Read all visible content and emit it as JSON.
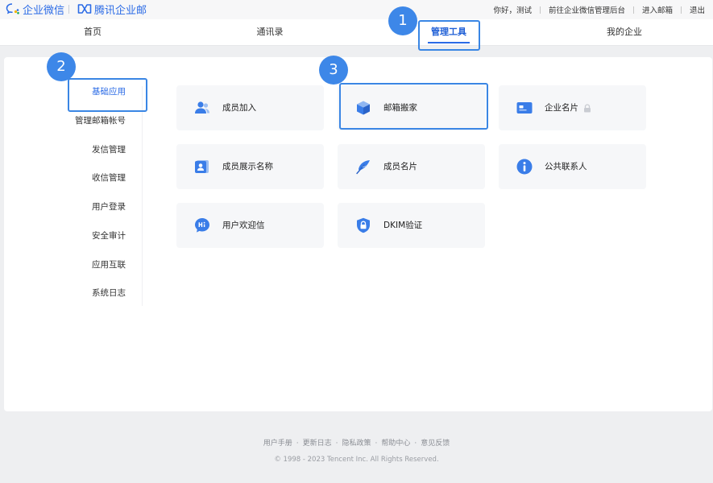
{
  "brand": {
    "wecom": "企业微信",
    "tencent_mail": "腾讯企业邮"
  },
  "top_links": {
    "greeting": "你好，测试",
    "admin_console": "前往企业微信管理后台",
    "enter_mailbox": "进入邮箱",
    "logout": "退出"
  },
  "nav": {
    "home": "首页",
    "contacts": "通讯录",
    "tools": "管理工具",
    "my_enterprise": "我的企业"
  },
  "sidebar": {
    "items": [
      {
        "label": "基础应用",
        "active": true
      },
      {
        "label": "管理邮箱帐号",
        "active": false
      },
      {
        "label": "发信管理",
        "active": false
      },
      {
        "label": "收信管理",
        "active": false
      },
      {
        "label": "用户登录",
        "active": false
      },
      {
        "label": "安全审计",
        "active": false
      },
      {
        "label": "应用互联",
        "active": false
      },
      {
        "label": "系统日志",
        "active": false
      }
    ]
  },
  "tiles": {
    "member_join": "成员加入",
    "mailbox_move": "邮箱搬家",
    "enterprise_card": "企业名片",
    "member_display_name": "成员展示名称",
    "member_card": "成员名片",
    "public_contacts": "公共联系人",
    "welcome_letter": "用户欢迎信",
    "dkim": "DKIM验证"
  },
  "annotations": {
    "badge1": "1",
    "badge2": "2",
    "badge3": "3"
  },
  "footer": {
    "links": [
      "用户手册",
      "更新日志",
      "隐私政策",
      "帮助中心",
      "意见反馈"
    ],
    "copyright": "© 1998 - 2023 Tencent Inc. All Rights Reserved."
  },
  "colors": {
    "accent": "#2b6be6",
    "annotation": "#3d87e8",
    "tile_bg": "#f6f7f9",
    "page_bg": "#eeeff1"
  }
}
